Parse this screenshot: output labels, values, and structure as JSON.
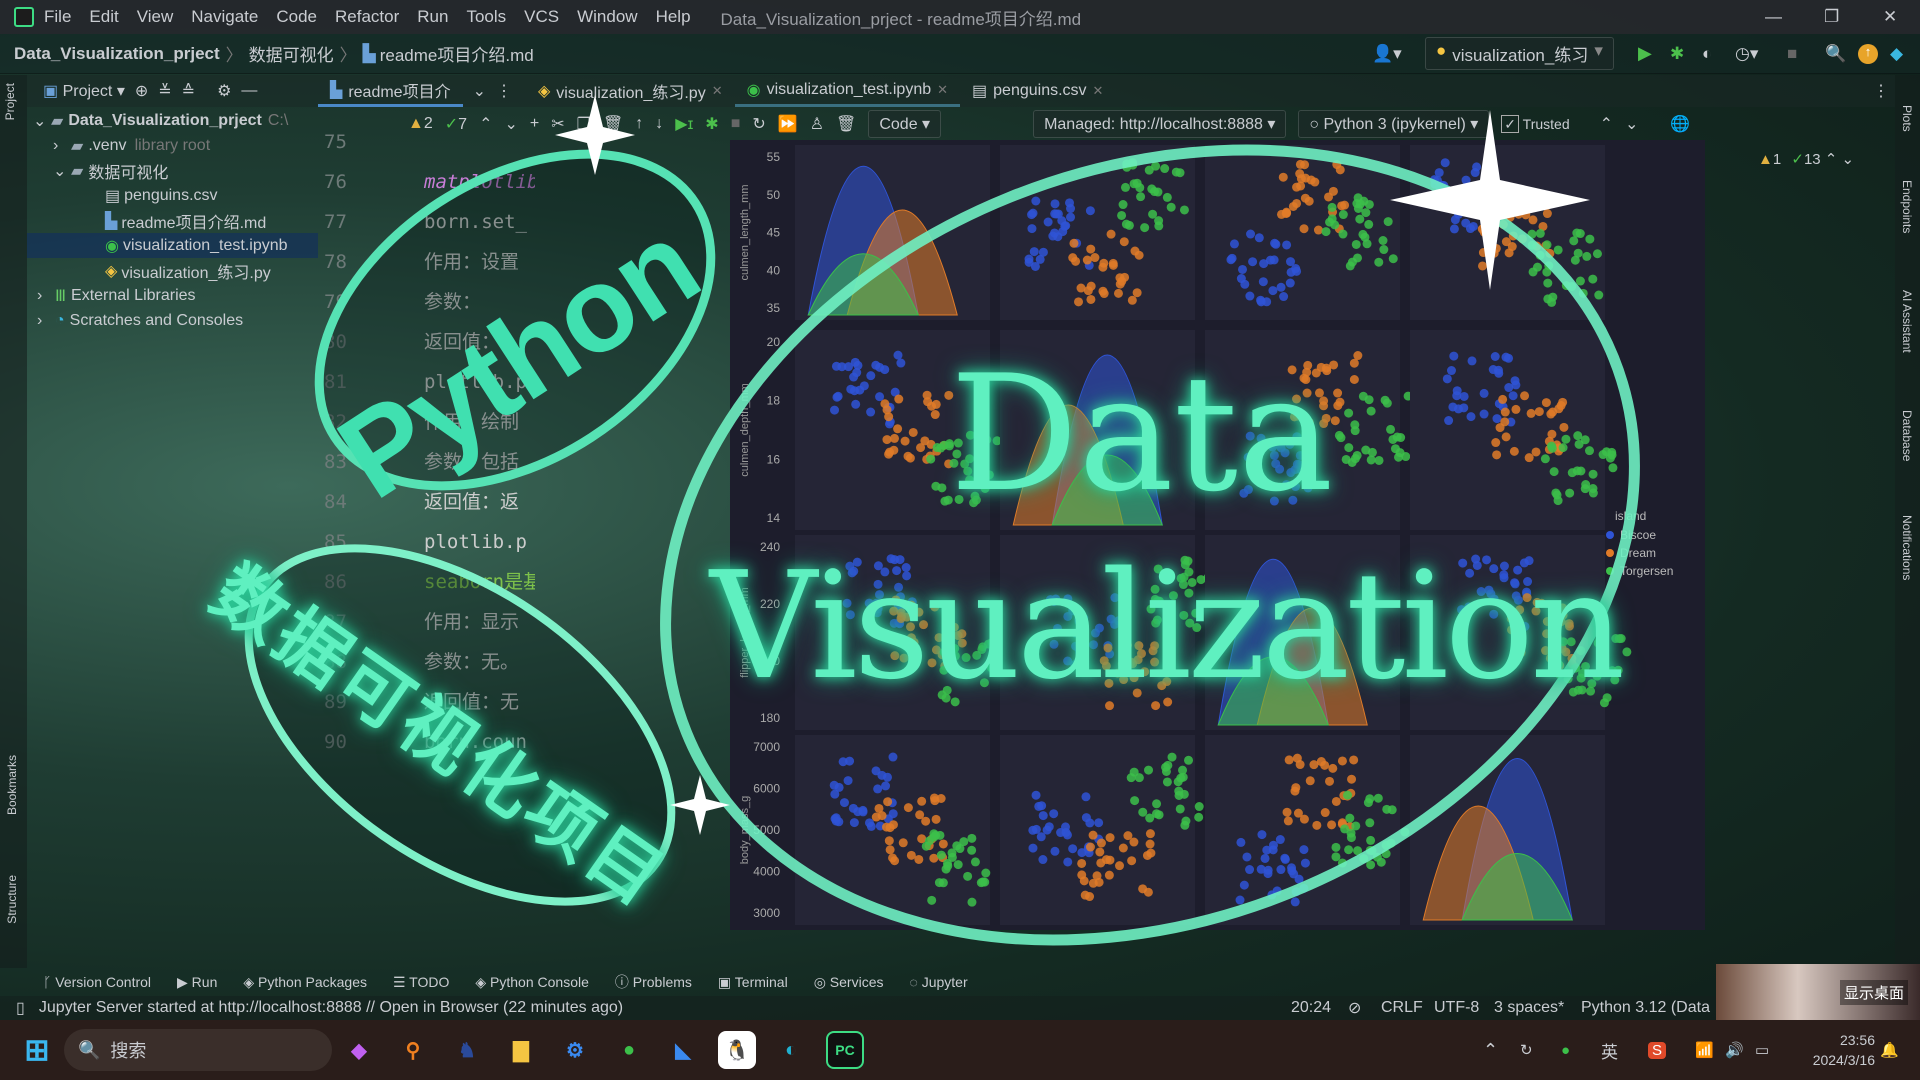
{
  "titlebar": {
    "menu": [
      "File",
      "Edit",
      "View",
      "Navigate",
      "Code",
      "Refactor",
      "Run",
      "Tools",
      "VCS",
      "Window",
      "Help"
    ],
    "title": "Data_Visualization_prject - readme项目介绍.md"
  },
  "navbar": {
    "crumbs": [
      "Data_Visualization_prject",
      "数据可视化",
      "readme项目介绍.md"
    ],
    "run_config": "visualization_练习"
  },
  "left_strip": {
    "project": "Project",
    "bookmarks": "Bookmarks",
    "structure": "Structure"
  },
  "right_strip": {
    "plots": "Plots",
    "endpoints": "Endpoints",
    "ai": "AI Assistant",
    "database": "Database",
    "notifications": "Notifications"
  },
  "project_panel": {
    "title": "Project",
    "tree": [
      {
        "label": "Data_Visualization_prject",
        "hint": "C:\\"
      },
      {
        "label": ".venv",
        "hint": "library root"
      },
      {
        "label": "数据可视化",
        "hint": ""
      },
      {
        "label": "penguins.csv",
        "hint": ""
      },
      {
        "label": "readme项目介绍.md",
        "hint": ""
      },
      {
        "label": "visualization_test.ipynb",
        "hint": ""
      },
      {
        "label": "visualization_练习.py",
        "hint": ""
      },
      {
        "label": "External Libraries",
        "hint": ""
      },
      {
        "label": "Scratches and Consoles",
        "hint": ""
      }
    ]
  },
  "tabs": [
    {
      "label": "readme项目介"
    },
    {
      "label": "visualization_练习.py"
    },
    {
      "label": "visualization_test.ipynb"
    },
    {
      "label": "penguins.csv"
    }
  ],
  "editor": {
    "warnings": "2",
    "checks": "7",
    "lines": [
      "75",
      "76",
      "77",
      "78",
      "79",
      "80",
      "81",
      "82",
      "83",
      "84",
      "85",
      "86",
      "87",
      "88",
      "89",
      "90"
    ],
    "code": [
      "",
      "matplotlib",
      "born.set_",
      "作用：设置",
      "参数：",
      "返回值：",
      "plotlib.p",
      "作用：绘制",
      "参数：包括",
      "返回值：返",
      "plotlib.p",
      "seaborn是基",
      "作用：显示",
      "参数：无。",
      "返回值：无",
      "born.coun"
    ]
  },
  "notebook": {
    "cell_type": "Code",
    "server": "Managed: http://localhost:8888",
    "kernel": "Python 3 (ipykernel)",
    "trusted": "Trusted",
    "warnings": "1",
    "checks": "13"
  },
  "plot": {
    "ylabels": [
      "culmen_length_mm",
      "culmen_depth_mm",
      "flipper_length_mm",
      "body_mass_g"
    ],
    "yticks": [
      [
        "55",
        "50",
        "45",
        "40",
        "35"
      ],
      [
        "20",
        "18",
        "16",
        "14"
      ],
      [
        "240",
        "220",
        "200",
        "180"
      ],
      [
        "7000",
        "6000",
        "5000",
        "4000",
        "3000"
      ]
    ],
    "legend": {
      "title": "island",
      "items": [
        "Biscoe",
        "Dream",
        "Torgersen"
      ]
    },
    "colors": {
      "Biscoe": "#2f54d6",
      "Dream": "#e07b28",
      "Torgersen": "#3cc04a"
    }
  },
  "overlay": {
    "python": "Python",
    "cn": "数据可视化项目",
    "data": "Data",
    "visualization": "Visualization"
  },
  "bottom_tools": [
    "Version Control",
    "Run",
    "Python Packages",
    "TODO",
    "Python Console",
    "Problems",
    "Terminal",
    "Services",
    "Jupyter"
  ],
  "status": {
    "message": "Jupyter Server started at http://localhost:8888 // Open in Browser (22 minutes ago)",
    "position": "20:24",
    "line_ending": "CRLF",
    "encoding": "UTF-8",
    "indent": "3 spaces*",
    "interpreter": "Python 3.12 (Data"
  },
  "taskbar": {
    "search": "搜索",
    "show_desktop": "显示桌面",
    "ime": "英",
    "time": "23:56",
    "date": "2024/3/16"
  }
}
